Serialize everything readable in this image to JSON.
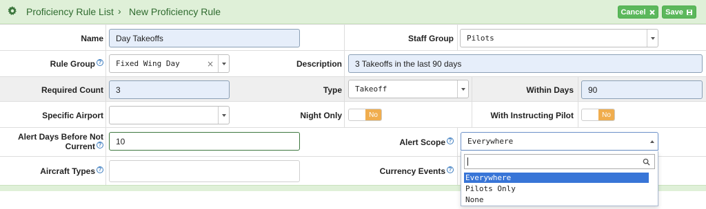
{
  "header": {
    "breadcrumb_parent": "Proficiency Rule List",
    "breadcrumb_sep": "›",
    "breadcrumb_current": "New Proficiency Rule",
    "cancel_label": "Cancel",
    "save_label": "Save"
  },
  "form": {
    "name_label": "Name",
    "name_value": "Day Takeoffs",
    "staff_group_label": "Staff Group",
    "staff_group_value": "Pilots",
    "rule_group_label": "Rule Group",
    "rule_group_value": "Fixed Wing Day",
    "description_label": "Description",
    "description_value": "3 Takeoffs in the last 90 days",
    "required_count_label": "Required Count",
    "required_count_value": "3",
    "type_label": "Type",
    "type_value": "Takeoff",
    "within_days_label": "Within Days",
    "within_days_value": "90",
    "specific_airport_label": "Specific Airport",
    "specific_airport_value": "",
    "night_only_label": "Night Only",
    "night_only_value": "No",
    "with_instructing_label": "With Instructing Pilot",
    "with_instructing_value": "No",
    "alert_days_label_1": "Alert Days Before Not",
    "alert_days_label_2": "Current",
    "alert_days_value": "10",
    "alert_scope_label": "Alert Scope",
    "alert_scope_value": "Everywhere",
    "aircraft_types_label": "Aircraft Types",
    "aircraft_types_value": "",
    "currency_events_label": "Currency Events",
    "info_glyph": "?"
  },
  "alert_scope_dropdown": {
    "options": [
      "Everywhere",
      "Pilots Only",
      "None"
    ],
    "selected_index": 0
  },
  "colors": {
    "header_bg": "#dff0d8",
    "button_green": "#5cb85c",
    "toggle_off": "#f0ad4e",
    "selected_option": "#3875d7"
  }
}
